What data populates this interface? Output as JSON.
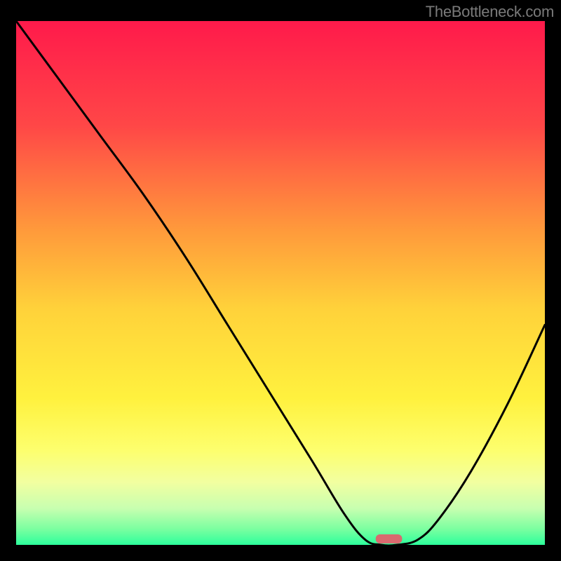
{
  "attribution": "TheBottleneck.com",
  "chart_data": {
    "type": "line",
    "title": "",
    "xlabel": "",
    "ylabel": "",
    "xlim": [
      0,
      100
    ],
    "ylim": [
      0,
      100
    ],
    "x": [
      0,
      8,
      16,
      24,
      32,
      40,
      48,
      56,
      62,
      66,
      69,
      72,
      76,
      80,
      86,
      93,
      100
    ],
    "series": [
      {
        "name": "bottleneck-curve",
        "values": [
          100,
          89,
          78,
          67,
          55,
          42,
          29,
          16,
          6,
          1,
          0,
          0,
          1,
          5,
          14,
          27,
          42
        ]
      }
    ],
    "optimal_marker": {
      "x_center": 70.5,
      "width": 5,
      "color": "#d96a6f"
    },
    "background": {
      "type": "vertical-gradient",
      "stops": [
        {
          "pos": 0.0,
          "color": "#ff1a4b"
        },
        {
          "pos": 0.2,
          "color": "#ff4747"
        },
        {
          "pos": 0.4,
          "color": "#ff9a3b"
        },
        {
          "pos": 0.55,
          "color": "#ffd23a"
        },
        {
          "pos": 0.72,
          "color": "#fff13e"
        },
        {
          "pos": 0.82,
          "color": "#fdff6e"
        },
        {
          "pos": 0.88,
          "color": "#f2ffa0"
        },
        {
          "pos": 0.93,
          "color": "#c8ffb0"
        },
        {
          "pos": 0.97,
          "color": "#7affa0"
        },
        {
          "pos": 1.0,
          "color": "#2cff9c"
        }
      ]
    }
  }
}
